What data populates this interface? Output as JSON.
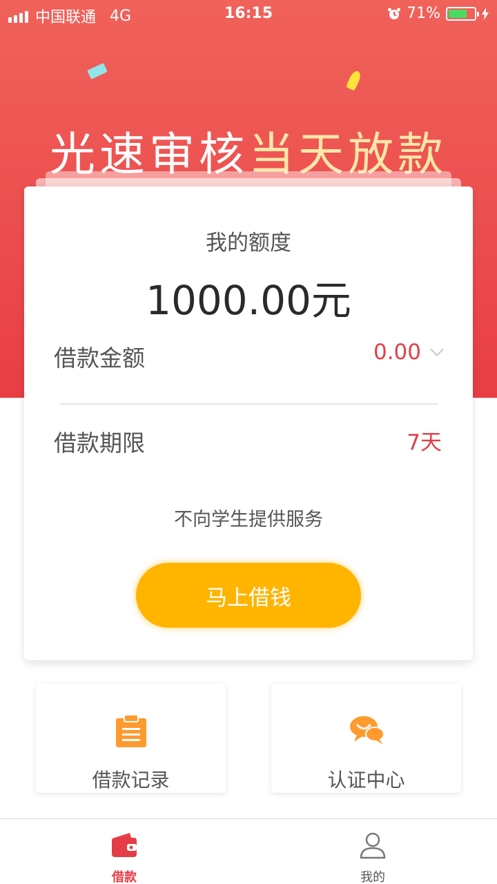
{
  "status_bar": {
    "carrier": "中国联通",
    "network": "4G",
    "time": "16:15",
    "battery": "71%",
    "battery_level": 0.71
  },
  "hero": {
    "slogan_part1": "光速审核",
    "slogan_part2": "当天放款"
  },
  "card": {
    "quota_label": "我的额度",
    "quota_value": "1000.00元",
    "amount_label": "借款金额",
    "amount_value": "0.00",
    "term_label": "借款期限",
    "term_value": "7天",
    "notice": "不向学生提供服务",
    "borrow_button": "马上借钱"
  },
  "tiles": {
    "records_label": "借款记录",
    "cert_label": "认证中心"
  },
  "tabbar": {
    "borrow_label": "借款",
    "mine_label": "我的"
  },
  "colors": {
    "primary_red": "#e53d46",
    "button_yellow": "#ffb400",
    "icon_orange": "#ff9a2e"
  }
}
